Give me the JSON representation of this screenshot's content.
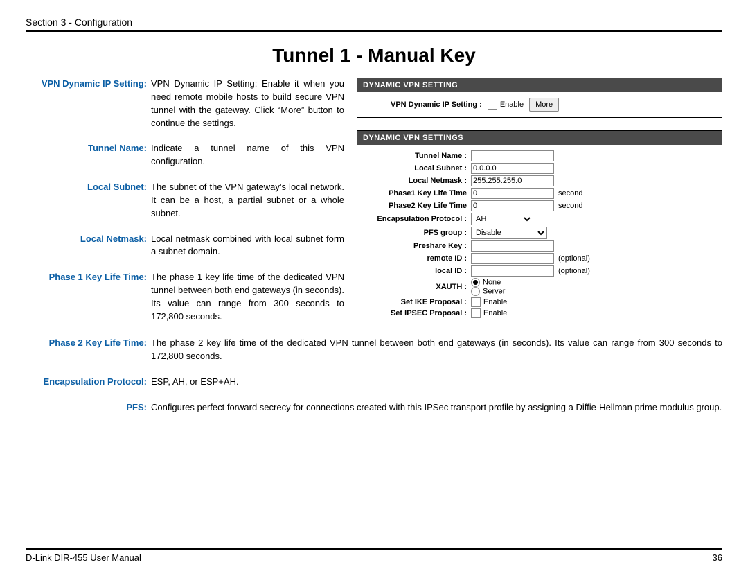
{
  "header": {
    "section": "Section 3 - Configuration"
  },
  "title": "Tunnel 1 - Manual Key",
  "definitions": [
    {
      "label": "VPN Dynamic IP Setting:",
      "text": "VPN Dynamic IP Setting: Enable it when you need remote mobile hosts to build secure VPN tunnel with the gateway. Click “More” button to continue the settings."
    },
    {
      "label": "Tunnel Name:",
      "text": "Indicate a tunnel name of this VPN configuration."
    },
    {
      "label": "Local Subnet:",
      "text": "The subnet of the VPN gateway’s local network. It can be a host, a partial subnet or a whole subnet."
    },
    {
      "label": "Local Netmask:",
      "text": "Local netmask combined with local subnet form a subnet domain."
    },
    {
      "label": "Phase 1 Key Life Time:",
      "text": "The phase 1 key life time of the dedicated VPN tunnel between both end gateways (in seconds). Its value can range from 300 seconds to 172,800 seconds."
    }
  ],
  "definitions_full": [
    {
      "label": "Phase 2 Key Life Time:",
      "text": "The phase 2 key life time of the dedicated VPN tunnel between both end gateways (in seconds). Its value can range from 300 seconds to 172,800 seconds."
    },
    {
      "label": "Encapsulation Protocol:",
      "text": "ESP, AH, or ESP+AH."
    },
    {
      "label": "PFS:",
      "text": "Configures perfect forward secrecy for connections created with this IPSec transport profile by assigning a Diffie-Hellman prime modulus group."
    }
  ],
  "panel1": {
    "title": "DYNAMIC VPN SETTING",
    "label": "VPN Dynamic IP Setting :",
    "enable": "Enable",
    "more": "More"
  },
  "panel2": {
    "title": "DYNAMIC VPN SETTINGS",
    "fields": {
      "tunnel_name": "Tunnel Name :",
      "local_subnet": "Local Subnet :",
      "local_subnet_v": "0.0.0.0",
      "local_netmask": "Local Netmask :",
      "local_netmask_v": "255.255.255.0",
      "p1": "Phase1 Key Life Time",
      "p1v": "0",
      "p2": "Phase2 Key Life Time",
      "p2v": "0",
      "second": "second",
      "encap": "Encapsulation Protocol :",
      "encap_v": "AH",
      "pfs": "PFS group :",
      "pfs_v": "Disable",
      "preshare": "Preshare Key :",
      "remote": "remote ID :",
      "local": "local ID :",
      "optional": "(optional)",
      "xauth": "XAUTH :",
      "xauth_none": "None",
      "xauth_server": "Server",
      "ike": "Set IKE Proposal :",
      "ipsec": "Set IPSEC Proposal :",
      "enable": "Enable"
    }
  },
  "footer": {
    "left": "D-Link DIR-455 User Manual",
    "right": "36"
  }
}
